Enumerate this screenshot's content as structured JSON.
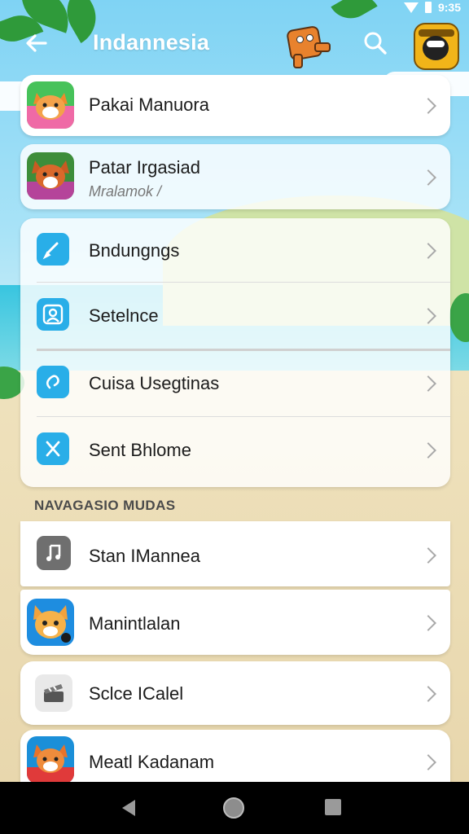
{
  "status_bar": {
    "time": "9:35"
  },
  "app_bar": {
    "title": "Indannesia",
    "icons": [
      "back-arrow-icon",
      "mascot-icon",
      "search-icon",
      "profile-avatar-icon"
    ]
  },
  "top_items": [
    {
      "label": "Pakai Manuora",
      "icon": "fox-app-icon"
    },
    {
      "label": "Patar Irgasiad",
      "sublabel": "Mralamok /",
      "icon": "fox-app-icon"
    }
  ],
  "settings_items": [
    {
      "label": "Bndungngs",
      "icon": "check-icon"
    },
    {
      "label": "Setelnce",
      "icon": "user-icon"
    },
    {
      "label": "Cuisa Usegtinas",
      "icon": "link-icon"
    },
    {
      "label": "Sent Bhlome",
      "icon": "tools-icon"
    }
  ],
  "section_header": "NAVAGASIO MUDAS",
  "section_items": [
    {
      "label": "Stan IMannea",
      "icon": "music-note-icon"
    },
    {
      "label": "Manintlalan",
      "icon": "cat-app-icon"
    },
    {
      "label": "Sclce ICalel",
      "icon": "clapperboard-icon"
    },
    {
      "label": "Meatl Kadanam",
      "icon": "fox-app-icon"
    }
  ],
  "colors": {
    "accent": "#29aee8",
    "sky": "#7fd3f4",
    "navbar": "#000000"
  },
  "nav_bar": {
    "icons": [
      "nav-back-icon",
      "nav-home-icon",
      "nav-recents-icon"
    ]
  }
}
